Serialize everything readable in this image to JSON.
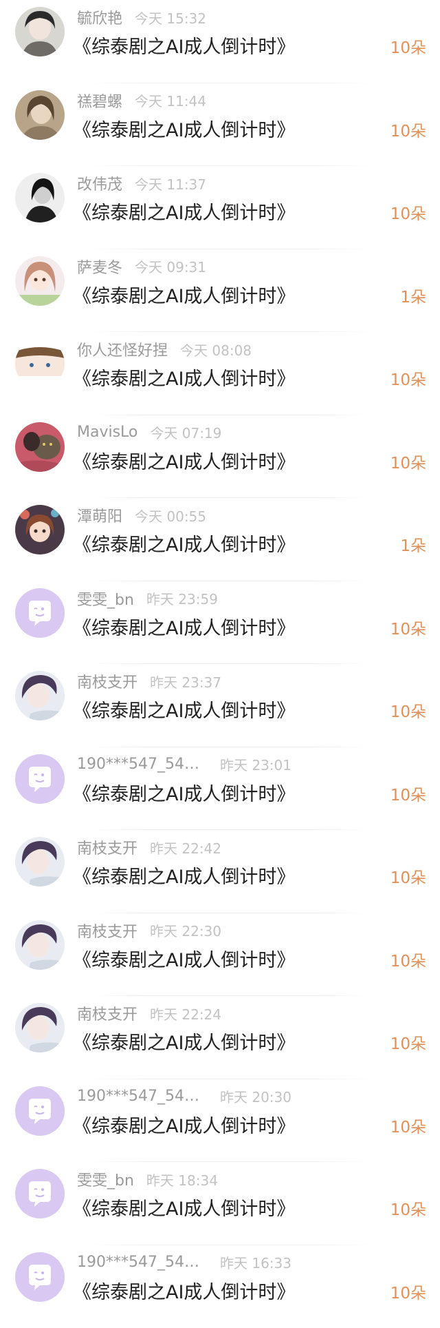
{
  "gift_records": [
    {
      "username": "毓欣艳",
      "time": "今天 15:32",
      "work_title": "《综泰剧之AI成人倒计时》",
      "gift_amount": "10朵",
      "avatar": "photo-avatar-dark-hair"
    },
    {
      "username": "禚碧螺",
      "time": "今天 11:44",
      "work_title": "《综泰剧之AI成人倒计时》",
      "gift_amount": "10朵",
      "avatar": "photo-avatar-sepia"
    },
    {
      "username": "改伟茂",
      "time": "今天 11:37",
      "work_title": "《综泰剧之AI成人倒计时》",
      "gift_amount": "10朵",
      "avatar": "photo-avatar-bw"
    },
    {
      "username": "萨麦冬",
      "time": "今天 09:31",
      "work_title": "《综泰剧之AI成人倒计时》",
      "gift_amount": "1朵",
      "avatar": "photo-avatar-doll"
    },
    {
      "username": "你人还怪好捏",
      "time": "今天 08:08",
      "work_title": "《综泰剧之AI成人倒计时》",
      "gift_amount": "10朵",
      "avatar": "photo-avatar-anime-boy"
    },
    {
      "username": "MavisLo",
      "time": "今天 07:19",
      "work_title": "《综泰剧之AI成人倒计时》",
      "gift_amount": "10朵",
      "avatar": "photo-avatar-cat"
    },
    {
      "username": "潭萌阳",
      "time": "今天 00:55",
      "work_title": "《综泰剧之AI成人倒计时》",
      "gift_amount": "1朵",
      "avatar": "photo-avatar-anime-girl"
    },
    {
      "username": "雯雯_bn",
      "time": "昨天 23:59",
      "work_title": "《综泰剧之AI成人倒计时》",
      "gift_amount": "10朵",
      "avatar": "default-avatar-icon"
    },
    {
      "username": "南枝支开",
      "time": "昨天 23:37",
      "work_title": "《综泰剧之AI成人倒计时》",
      "gift_amount": "10朵",
      "avatar": "photo-avatar-anime-man"
    },
    {
      "username": "190***547_543...",
      "time": "昨天 23:01",
      "work_title": "《综泰剧之AI成人倒计时》",
      "gift_amount": "10朵",
      "avatar": "default-avatar-icon"
    },
    {
      "username": "南枝支开",
      "time": "昨天 22:42",
      "work_title": "《综泰剧之AI成人倒计时》",
      "gift_amount": "10朵",
      "avatar": "photo-avatar-anime-man"
    },
    {
      "username": "南枝支开",
      "time": "昨天 22:30",
      "work_title": "《综泰剧之AI成人倒计时》",
      "gift_amount": "10朵",
      "avatar": "photo-avatar-anime-man"
    },
    {
      "username": "南枝支开",
      "time": "昨天 22:24",
      "work_title": "《综泰剧之AI成人倒计时》",
      "gift_amount": "10朵",
      "avatar": "photo-avatar-anime-man"
    },
    {
      "username": "190***547_543...",
      "time": "昨天 20:30",
      "work_title": "《综泰剧之AI成人倒计时》",
      "gift_amount": "10朵",
      "avatar": "default-avatar-icon"
    },
    {
      "username": "雯雯_bn",
      "time": "昨天 18:34",
      "work_title": "《综泰剧之AI成人倒计时》",
      "gift_amount": "10朵",
      "avatar": "default-avatar-icon"
    },
    {
      "username": "190***547_543...",
      "time": "昨天 16:33",
      "work_title": "《综泰剧之AI成人倒计时》",
      "gift_amount": "10朵",
      "avatar": "default-avatar-icon"
    }
  ],
  "colors": {
    "gift_accent": "#e0915a",
    "default_avatar_bg": "#d8c8f2",
    "username_text": "#9a9a9a",
    "time_text": "#c2c2c2",
    "title_text": "#222222"
  }
}
